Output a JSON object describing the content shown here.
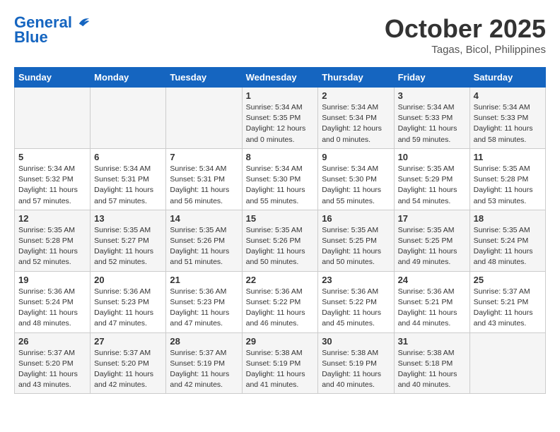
{
  "header": {
    "logo_line1": "General",
    "logo_line2": "Blue",
    "month": "October 2025",
    "location": "Tagas, Bicol, Philippines"
  },
  "weekdays": [
    "Sunday",
    "Monday",
    "Tuesday",
    "Wednesday",
    "Thursday",
    "Friday",
    "Saturday"
  ],
  "weeks": [
    [
      {
        "day": "",
        "info": ""
      },
      {
        "day": "",
        "info": ""
      },
      {
        "day": "",
        "info": ""
      },
      {
        "day": "1",
        "info": "Sunrise: 5:34 AM\nSunset: 5:35 PM\nDaylight: 12 hours\nand 0 minutes."
      },
      {
        "day": "2",
        "info": "Sunrise: 5:34 AM\nSunset: 5:34 PM\nDaylight: 12 hours\nand 0 minutes."
      },
      {
        "day": "3",
        "info": "Sunrise: 5:34 AM\nSunset: 5:33 PM\nDaylight: 11 hours\nand 59 minutes."
      },
      {
        "day": "4",
        "info": "Sunrise: 5:34 AM\nSunset: 5:33 PM\nDaylight: 11 hours\nand 58 minutes."
      }
    ],
    [
      {
        "day": "5",
        "info": "Sunrise: 5:34 AM\nSunset: 5:32 PM\nDaylight: 11 hours\nand 57 minutes."
      },
      {
        "day": "6",
        "info": "Sunrise: 5:34 AM\nSunset: 5:31 PM\nDaylight: 11 hours\nand 57 minutes."
      },
      {
        "day": "7",
        "info": "Sunrise: 5:34 AM\nSunset: 5:31 PM\nDaylight: 11 hours\nand 56 minutes."
      },
      {
        "day": "8",
        "info": "Sunrise: 5:34 AM\nSunset: 5:30 PM\nDaylight: 11 hours\nand 55 minutes."
      },
      {
        "day": "9",
        "info": "Sunrise: 5:34 AM\nSunset: 5:30 PM\nDaylight: 11 hours\nand 55 minutes."
      },
      {
        "day": "10",
        "info": "Sunrise: 5:35 AM\nSunset: 5:29 PM\nDaylight: 11 hours\nand 54 minutes."
      },
      {
        "day": "11",
        "info": "Sunrise: 5:35 AM\nSunset: 5:28 PM\nDaylight: 11 hours\nand 53 minutes."
      }
    ],
    [
      {
        "day": "12",
        "info": "Sunrise: 5:35 AM\nSunset: 5:28 PM\nDaylight: 11 hours\nand 52 minutes."
      },
      {
        "day": "13",
        "info": "Sunrise: 5:35 AM\nSunset: 5:27 PM\nDaylight: 11 hours\nand 52 minutes."
      },
      {
        "day": "14",
        "info": "Sunrise: 5:35 AM\nSunset: 5:26 PM\nDaylight: 11 hours\nand 51 minutes."
      },
      {
        "day": "15",
        "info": "Sunrise: 5:35 AM\nSunset: 5:26 PM\nDaylight: 11 hours\nand 50 minutes."
      },
      {
        "day": "16",
        "info": "Sunrise: 5:35 AM\nSunset: 5:25 PM\nDaylight: 11 hours\nand 50 minutes."
      },
      {
        "day": "17",
        "info": "Sunrise: 5:35 AM\nSunset: 5:25 PM\nDaylight: 11 hours\nand 49 minutes."
      },
      {
        "day": "18",
        "info": "Sunrise: 5:35 AM\nSunset: 5:24 PM\nDaylight: 11 hours\nand 48 minutes."
      }
    ],
    [
      {
        "day": "19",
        "info": "Sunrise: 5:36 AM\nSunset: 5:24 PM\nDaylight: 11 hours\nand 48 minutes."
      },
      {
        "day": "20",
        "info": "Sunrise: 5:36 AM\nSunset: 5:23 PM\nDaylight: 11 hours\nand 47 minutes."
      },
      {
        "day": "21",
        "info": "Sunrise: 5:36 AM\nSunset: 5:23 PM\nDaylight: 11 hours\nand 47 minutes."
      },
      {
        "day": "22",
        "info": "Sunrise: 5:36 AM\nSunset: 5:22 PM\nDaylight: 11 hours\nand 46 minutes."
      },
      {
        "day": "23",
        "info": "Sunrise: 5:36 AM\nSunset: 5:22 PM\nDaylight: 11 hours\nand 45 minutes."
      },
      {
        "day": "24",
        "info": "Sunrise: 5:36 AM\nSunset: 5:21 PM\nDaylight: 11 hours\nand 44 minutes."
      },
      {
        "day": "25",
        "info": "Sunrise: 5:37 AM\nSunset: 5:21 PM\nDaylight: 11 hours\nand 43 minutes."
      }
    ],
    [
      {
        "day": "26",
        "info": "Sunrise: 5:37 AM\nSunset: 5:20 PM\nDaylight: 11 hours\nand 43 minutes."
      },
      {
        "day": "27",
        "info": "Sunrise: 5:37 AM\nSunset: 5:20 PM\nDaylight: 11 hours\nand 42 minutes."
      },
      {
        "day": "28",
        "info": "Sunrise: 5:37 AM\nSunset: 5:19 PM\nDaylight: 11 hours\nand 42 minutes."
      },
      {
        "day": "29",
        "info": "Sunrise: 5:38 AM\nSunset: 5:19 PM\nDaylight: 11 hours\nand 41 minutes."
      },
      {
        "day": "30",
        "info": "Sunrise: 5:38 AM\nSunset: 5:19 PM\nDaylight: 11 hours\nand 40 minutes."
      },
      {
        "day": "31",
        "info": "Sunrise: 5:38 AM\nSunset: 5:18 PM\nDaylight: 11 hours\nand 40 minutes."
      },
      {
        "day": "",
        "info": ""
      }
    ]
  ]
}
